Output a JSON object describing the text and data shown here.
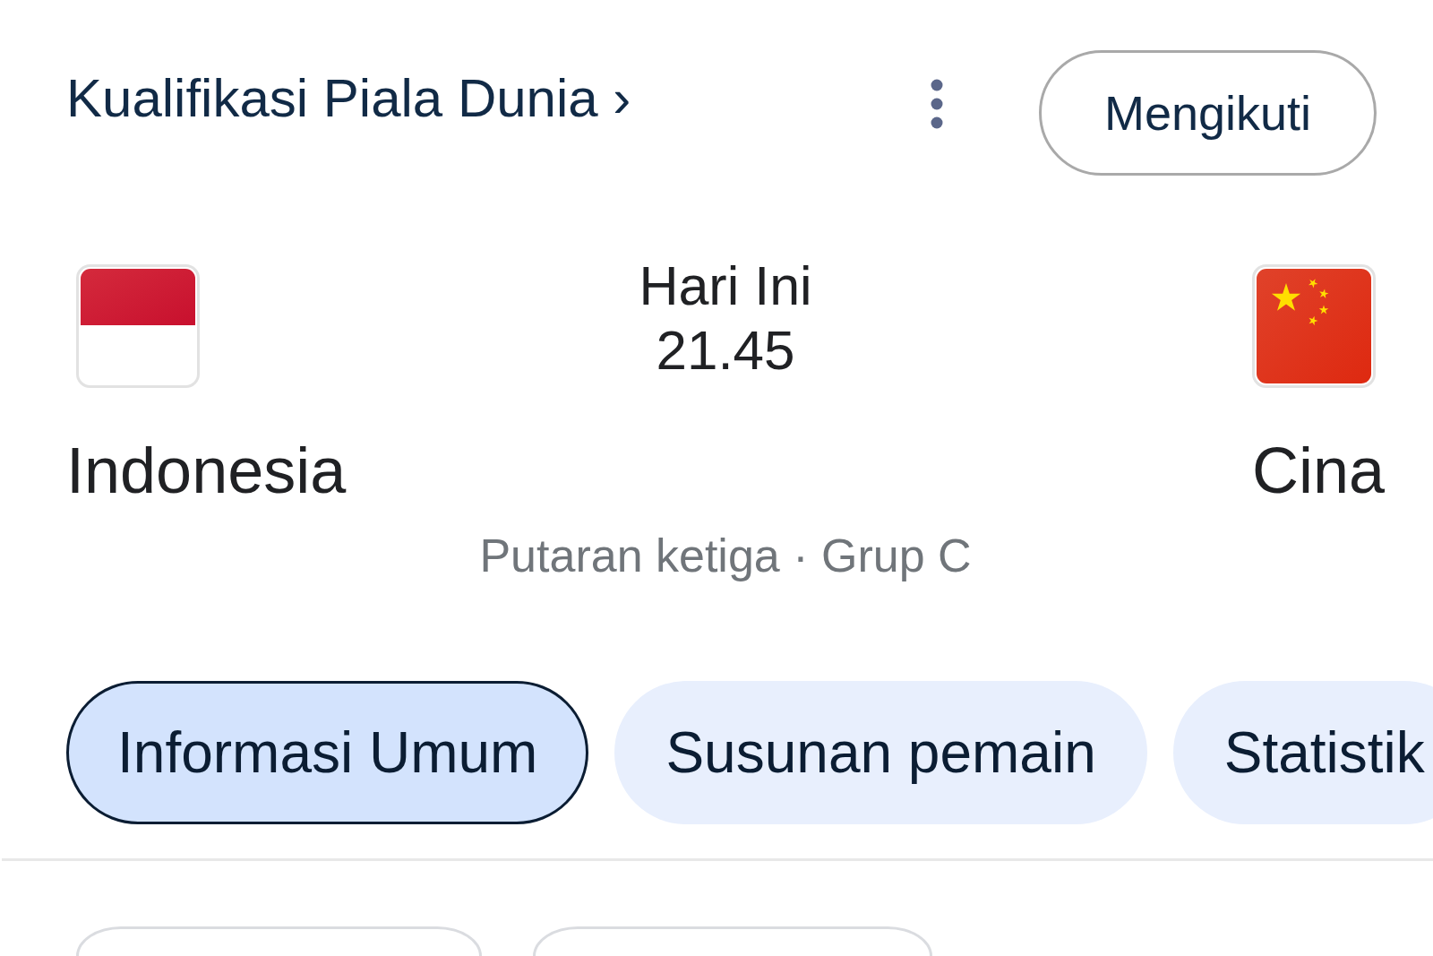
{
  "header": {
    "competition_link": "Kualifikasi Piala Dunia ›",
    "follow_button": "Mengikuti"
  },
  "match": {
    "home_team": {
      "name": "Indonesia"
    },
    "away_team": {
      "name": "Cina"
    },
    "day": "Hari Ini",
    "time": "21.45",
    "stage": "Putaran ketiga · Grup C"
  },
  "tabs": [
    {
      "label": "Informasi Umum",
      "selected": true
    },
    {
      "label": "Susunan pemain",
      "selected": false
    },
    {
      "label": "Statistik",
      "selected": false
    }
  ]
}
